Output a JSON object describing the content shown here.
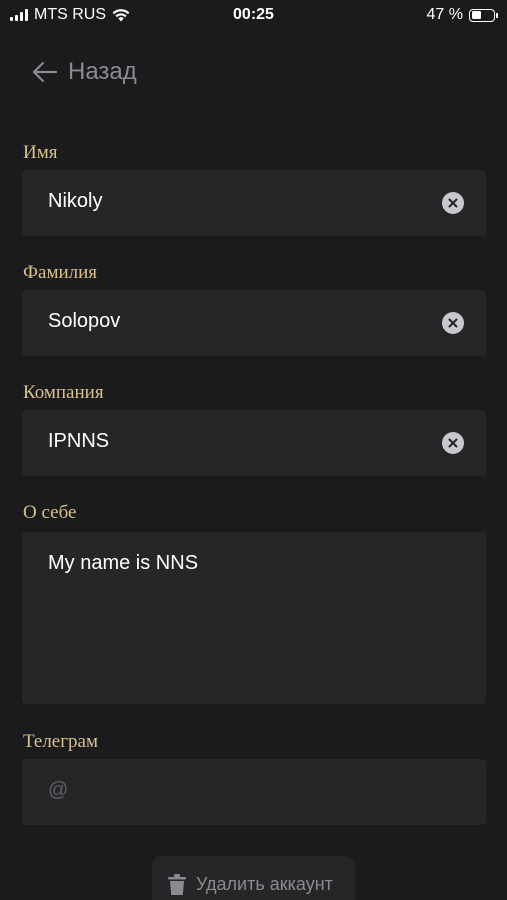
{
  "status_bar": {
    "carrier": "MTS RUS",
    "time": "00:25",
    "battery_percent": "47 %",
    "battery_level": 0.47
  },
  "nav": {
    "back_label": "Назад"
  },
  "form": {
    "first_name": {
      "label": "Имя",
      "value": "Nikoly"
    },
    "last_name": {
      "label": "Фамилия",
      "value": "Solopov"
    },
    "company": {
      "label": "Компания",
      "value": "IPNNS"
    },
    "about": {
      "label": "О себе",
      "value": "My name is NNS"
    },
    "telegram": {
      "label": "Телеграм",
      "value": "",
      "placeholder": "@"
    }
  },
  "actions": {
    "delete_label": "Удалить аккаунт"
  },
  "icons": {
    "back": "arrow-left-icon",
    "clear": "clear-circle-icon",
    "delete": "trash-icon",
    "wifi": "wifi-icon",
    "signal": "signal-icon",
    "battery": "battery-icon"
  },
  "colors": {
    "background": "#1b1b1d",
    "field_background": "#262628",
    "label": "#d8c28a",
    "muted": "#8a8a8f"
  }
}
